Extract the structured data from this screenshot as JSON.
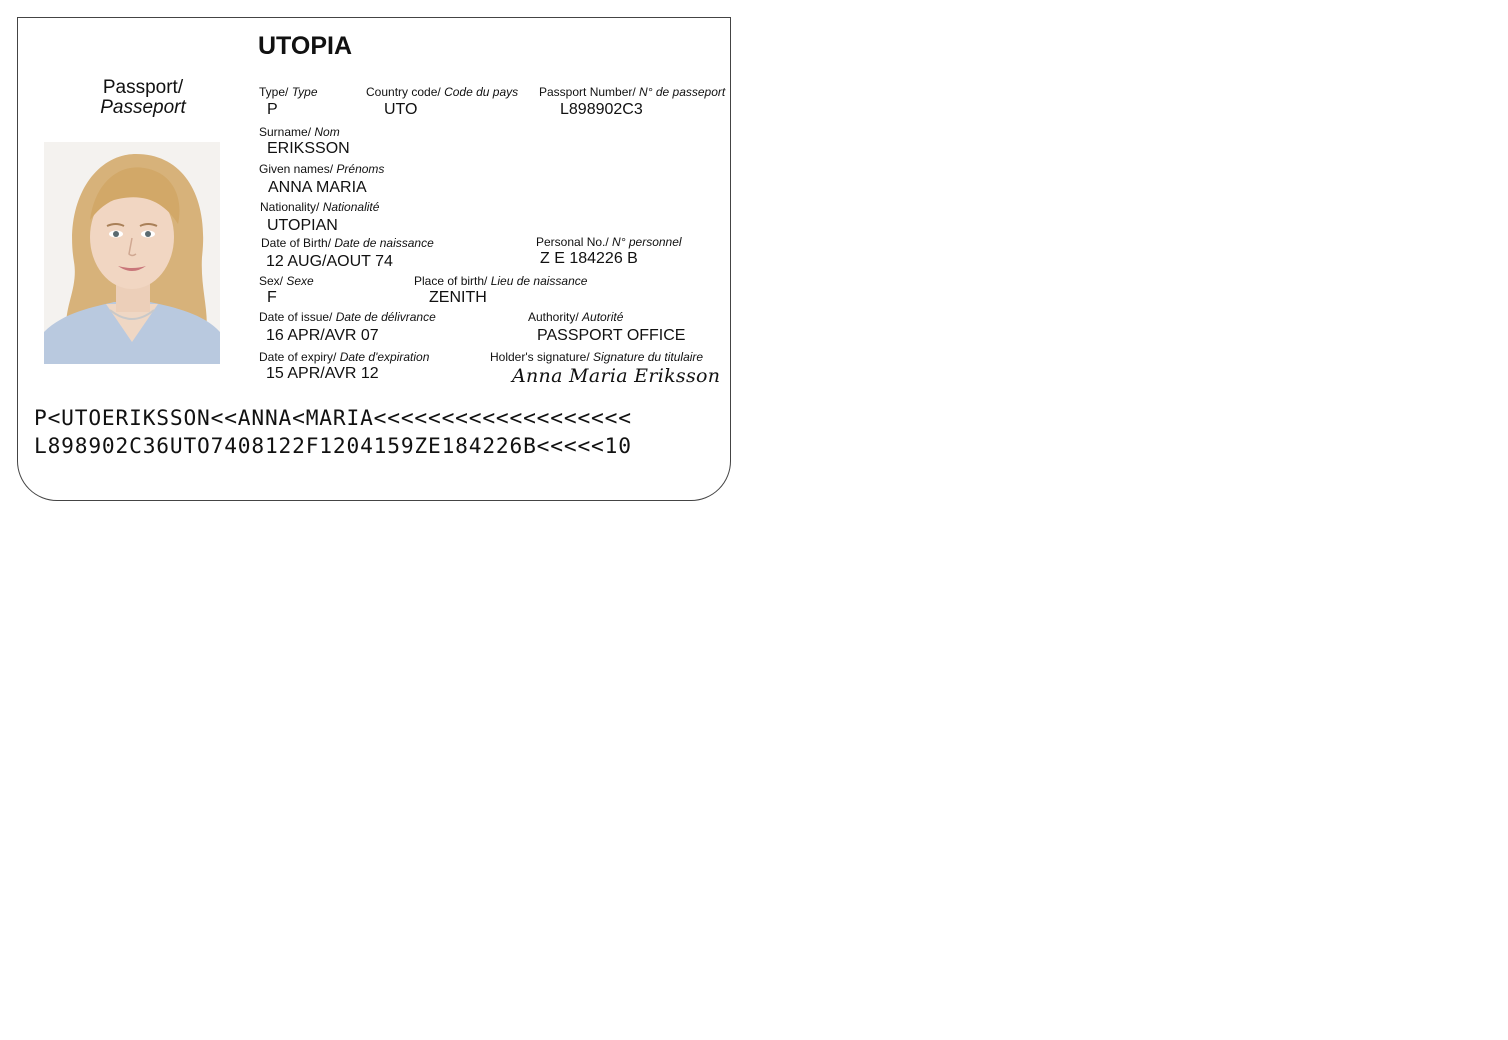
{
  "passport": {
    "country_title": "UTOPIA",
    "doc_title_en": "Passport/",
    "doc_title_fr": "Passeport",
    "fields": {
      "type": {
        "label_en": "Type/",
        "label_fr": "Type",
        "value": "P"
      },
      "country_code": {
        "label_en": "Country code/",
        "label_fr": "Code du pays",
        "value": "UTO"
      },
      "passport_number": {
        "label_en": "Passport Number/",
        "label_fr": "N° de passeport",
        "value": "L898902C3"
      },
      "surname": {
        "label_en": "Surname/",
        "label_fr": "Nom",
        "value": "ERIKSSON"
      },
      "given_names": {
        "label_en": "Given names/",
        "label_fr": "Prénoms",
        "value": "ANNA MARIA"
      },
      "nationality": {
        "label_en": "Nationality/",
        "label_fr": "Nationalité",
        "value": "UTOPIAN"
      },
      "date_of_birth": {
        "label_en": "Date of Birth/",
        "label_fr": "Date de naissance",
        "value": "12 AUG/AOUT 74"
      },
      "personal_no": {
        "label_en": "Personal No./",
        "label_fr": "N° personnel",
        "value": "Z E 184226 B"
      },
      "sex": {
        "label_en": "Sex/",
        "label_fr": "Sexe",
        "value": "F"
      },
      "place_of_birth": {
        "label_en": "Place of birth/",
        "label_fr": "Lieu de naissance",
        "value": "ZENITH"
      },
      "date_of_issue": {
        "label_en": "Date of issue/",
        "label_fr": "Date de délivrance",
        "value": "16 APR/AVR 07"
      },
      "authority": {
        "label_en": "Authority/",
        "label_fr": "Autorité",
        "value": "PASSPORT OFFICE"
      },
      "date_of_expiry": {
        "label_en": "Date of expiry/",
        "label_fr": "Date d'expiration",
        "value": "15 APR/AVR 12"
      },
      "signature": {
        "label_en": "Holder's signature/",
        "label_fr": "Signature du titulaire",
        "value": "Anna Maria Eriksson"
      }
    },
    "mrz": {
      "line1": "P<UTOERIKSSON<<ANNA<MARIA<<<<<<<<<<<<<<<<<<<",
      "line2": "L898902C36UTO7408122F1204159ZE184226B<<<<<10"
    },
    "photo": {
      "icon": "holder-portrait-photo"
    }
  }
}
